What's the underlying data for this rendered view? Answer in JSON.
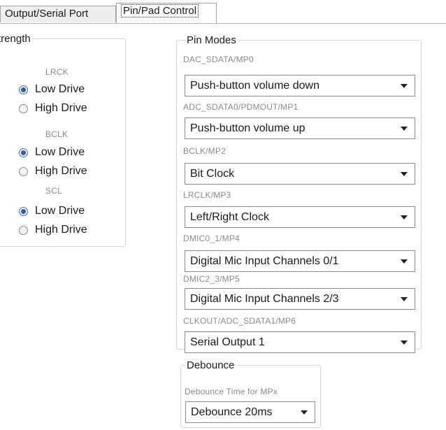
{
  "tabs": [
    {
      "label": "Output/Serial Port",
      "active": false
    },
    {
      "label": "Pin/Pad Control",
      "active": true
    }
  ],
  "strength": {
    "legend": "trength",
    "groups": [
      {
        "label": "LRCK",
        "options": [
          "Low Drive",
          "High Drive"
        ],
        "selected": "Low Drive"
      },
      {
        "label": "BCLK",
        "options": [
          "Low Drive",
          "High Drive"
        ],
        "selected": "Low Drive"
      },
      {
        "label": "SCL",
        "options": [
          "Low Drive",
          "High Drive"
        ],
        "selected": "Low Drive"
      }
    ]
  },
  "pin_modes": {
    "legend": "Pin Modes",
    "pins": [
      {
        "label": "DAC_SDATA/MP0",
        "value": "Push-button volume down"
      },
      {
        "label": "ADC_SDATA0/PDMOUT/MP1",
        "value": "Push-button volume up"
      },
      {
        "label": "BCLK/MP2",
        "value": "Bit Clock"
      },
      {
        "label": "LRCLK/MP3",
        "value": "Left/Right Clock"
      },
      {
        "label": "DMIC0_1/MP4",
        "value": "Digital Mic Input Channels 0/1"
      },
      {
        "label": "DMIC2_3/MP5",
        "value": "Digital Mic Input Channels 2/3"
      },
      {
        "label": "CLKOUT/ADC_SDATA1/MP6",
        "value": "Serial Output 1"
      }
    ]
  },
  "debounce": {
    "legend": "Debounce",
    "label": "Debounce Time for MPx",
    "value": "Debounce 20ms"
  },
  "icons": {
    "dropdown": "chevron-down-icon",
    "radio_selected": "radio-selected-icon",
    "radio_unselected": "radio-unselected-icon"
  },
  "colors": {
    "radio_accent": "#2d5fb0",
    "border": "#8a8a8a",
    "label_gray": "#8a8a8a"
  }
}
